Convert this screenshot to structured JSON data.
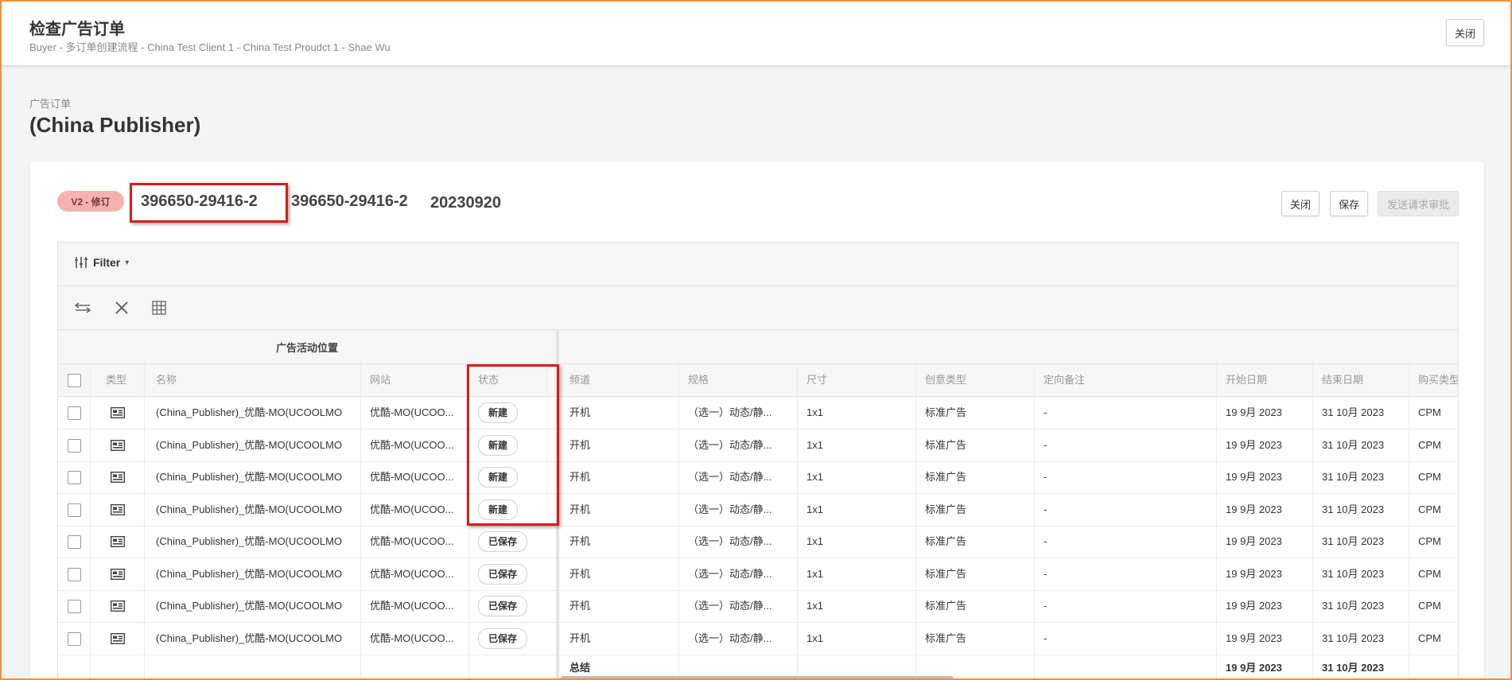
{
  "header": {
    "title": "检查广告订单",
    "subtitle": "Buyer - 多订单创建流程 - China Test Client 1 - China Test Proudct 1 - Shae Wu",
    "close_label": "关闭"
  },
  "page": {
    "breadcrumb": "广告订单",
    "publisher": "(China Publisher)"
  },
  "order": {
    "version_badge": "V2 - 修订",
    "id_primary": "396650-29416-2",
    "id_secondary": "396650-29416-2",
    "date": "20230920",
    "close_label": "关闭",
    "save_label": "保存",
    "submit_label": "发送请求审批"
  },
  "filter": {
    "label": "Filter",
    "caret": "▾"
  },
  "toolbar_icons": [
    "swap-icon",
    "close-icon",
    "grid-icon"
  ],
  "table": {
    "group_header": "广告活动位置",
    "columns": {
      "type": "类型",
      "name": "名称",
      "site": "网站",
      "status": "状态",
      "channel": "频道",
      "spec": "规格",
      "size": "尺寸",
      "creative_type": "创意类型",
      "targeting": "定向备注",
      "start": "开始日期",
      "end": "结束日期",
      "buy_type": "购买类型"
    },
    "rows": [
      {
        "name": "(China_Publisher)_优酷-MO(UCOOLMO...",
        "site": "优酷-MO(UCOO...",
        "status": "新建",
        "channel": "开机",
        "spec": "（选一）动态/静...",
        "size": "1x1",
        "creative_type": "标准广告",
        "targeting": "-",
        "start": "19 9月 2023",
        "end": "31 10月 2023",
        "buy_type": "CPM"
      },
      {
        "name": "(China_Publisher)_优酷-MO(UCOOLMO...",
        "site": "优酷-MO(UCOO...",
        "status": "新建",
        "channel": "开机",
        "spec": "（选一）动态/静...",
        "size": "1x1",
        "creative_type": "标准广告",
        "targeting": "-",
        "start": "19 9月 2023",
        "end": "31 10月 2023",
        "buy_type": "CPM"
      },
      {
        "name": "(China_Publisher)_优酷-MO(UCOOLMO...",
        "site": "优酷-MO(UCOO...",
        "status": "新建",
        "channel": "开机",
        "spec": "（选一）动态/静...",
        "size": "1x1",
        "creative_type": "标准广告",
        "targeting": "-",
        "start": "19 9月 2023",
        "end": "31 10月 2023",
        "buy_type": "CPM"
      },
      {
        "name": "(China_Publisher)_优酷-MO(UCOOLMO...",
        "site": "优酷-MO(UCOO...",
        "status": "新建",
        "channel": "开机",
        "spec": "（选一）动态/静...",
        "size": "1x1",
        "creative_type": "标准广告",
        "targeting": "-",
        "start": "19 9月 2023",
        "end": "31 10月 2023",
        "buy_type": "CPM"
      },
      {
        "name": "(China_Publisher)_优酷-MO(UCOOLMO...",
        "site": "优酷-MO(UCOO...",
        "status": "已保存",
        "channel": "开机",
        "spec": "（选一）动态/静...",
        "size": "1x1",
        "creative_type": "标准广告",
        "targeting": "-",
        "start": "19 9月 2023",
        "end": "31 10月 2023",
        "buy_type": "CPM"
      },
      {
        "name": "(China_Publisher)_优酷-MO(UCOOLMO...",
        "site": "优酷-MO(UCOO...",
        "status": "已保存",
        "channel": "开机",
        "spec": "（选一）动态/静...",
        "size": "1x1",
        "creative_type": "标准广告",
        "targeting": "-",
        "start": "19 9月 2023",
        "end": "31 10月 2023",
        "buy_type": "CPM"
      },
      {
        "name": "(China_Publisher)_优酷-MO(UCOOLMO...",
        "site": "优酷-MO(UCOO...",
        "status": "已保存",
        "channel": "开机",
        "spec": "（选一）动态/静...",
        "size": "1x1",
        "creative_type": "标准广告",
        "targeting": "-",
        "start": "19 9月 2023",
        "end": "31 10月 2023",
        "buy_type": "CPM"
      },
      {
        "name": "(China_Publisher)_优酷-MO(UCOOLMO...",
        "site": "优酷-MO(UCOO...",
        "status": "已保存",
        "channel": "开机",
        "spec": "（选一）动态/静...",
        "size": "1x1",
        "creative_type": "标准广告",
        "targeting": "-",
        "start": "19 9月 2023",
        "end": "31 10月 2023",
        "buy_type": "CPM"
      }
    ],
    "summary": {
      "label": "总结",
      "start": "19 9月 2023",
      "end": "31 10月 2023"
    }
  },
  "colors": {
    "frame_border": "#f0923a",
    "highlight": "#d91a1a",
    "badge_bg": "#f4b4ad"
  }
}
